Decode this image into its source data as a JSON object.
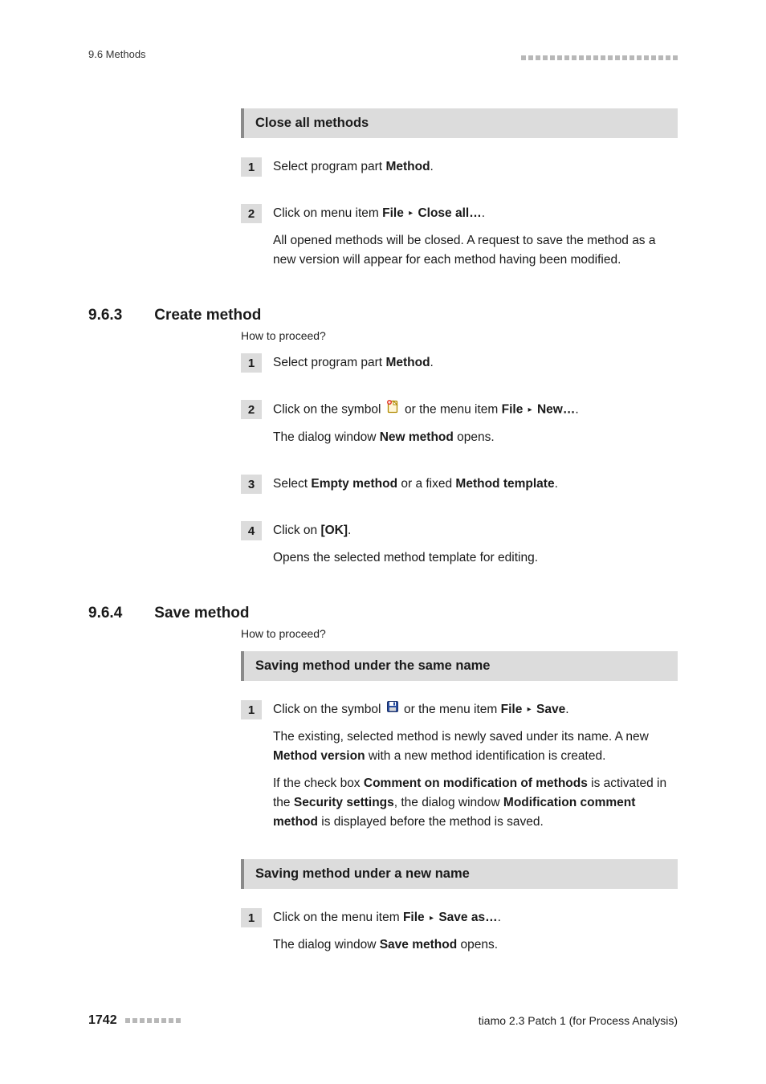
{
  "header": {
    "left": "9.6 Methods"
  },
  "box1": {
    "title": "Close all methods",
    "step1_a": "Select program part ",
    "step1_b": "Method",
    "step1_c": ".",
    "step2_a": "Click on menu item ",
    "step2_file": "File",
    "step2_close": "Close all…",
    "step2_d": ".",
    "step2_note": "All opened methods will be closed. A request to save the method as a new version will appear for each method having been modified."
  },
  "sec963": {
    "num": "9.6.3",
    "title": "Create method",
    "howto": "How to proceed?",
    "s1_a": "Select program part ",
    "s1_b": "Method",
    "s1_c": ".",
    "s2_a": "Click on the symbol ",
    "s2_b": " or the menu item ",
    "s2_file": "File",
    "s2_new": "New…",
    "s2_d": ".",
    "s2_note_a": "The dialog window ",
    "s2_note_b": "New method",
    "s2_note_c": " opens.",
    "s3_a": "Select ",
    "s3_b": "Empty method",
    "s3_c": " or a fixed ",
    "s3_d": "Method template",
    "s3_e": ".",
    "s4_a": "Click on ",
    "s4_b": "[OK]",
    "s4_c": ".",
    "s4_note": "Opens the selected method template for editing."
  },
  "sec964": {
    "num": "9.6.4",
    "title": "Save method",
    "howto": "How to proceed?",
    "box_same": "Saving method under the same name",
    "same_s1_a": "Click on the symbol ",
    "same_s1_b": " or the menu item ",
    "same_s1_file": "File",
    "same_s1_save": "Save",
    "same_s1_d": ".",
    "same_p1_a": "The existing, selected method is newly saved under its name. A new ",
    "same_p1_b": "Method version",
    "same_p1_c": " with a new method identification is created.",
    "same_p2_a": "If the check box ",
    "same_p2_b": "Comment on modification of methods",
    "same_p2_c": " is activated in the ",
    "same_p2_d": "Security settings",
    "same_p2_e": ", the dialog window ",
    "same_p2_f": "Modification comment method",
    "same_p2_g": " is displayed before the method is saved.",
    "box_new": "Saving method under a new name",
    "new_s1_a": "Click on the menu item ",
    "new_s1_file": "File",
    "new_s1_saveas": "Save as…",
    "new_s1_d": ".",
    "new_note_a": "The dialog window ",
    "new_note_b": "Save method",
    "new_note_c": " opens."
  },
  "footer": {
    "page": "1742",
    "right": "tiamo 2.3 Patch 1 (for Process Analysis)"
  },
  "glyphs": {
    "triangle": "▸"
  }
}
